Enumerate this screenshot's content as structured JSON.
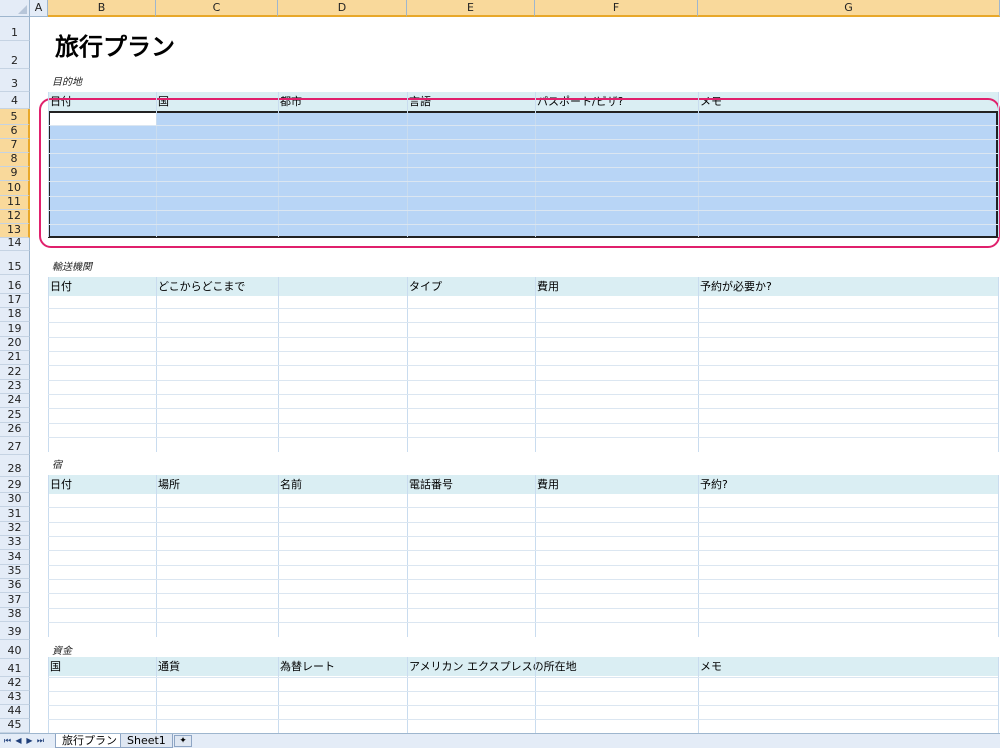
{
  "columns": [
    "A",
    "B",
    "C",
    "D",
    "E",
    "F",
    "G"
  ],
  "rows": [
    "1",
    "2",
    "3",
    "4",
    "5",
    "6",
    "7",
    "8",
    "9",
    "10",
    "11",
    "12",
    "13",
    "14",
    "15",
    "16",
    "17",
    "18",
    "19",
    "20",
    "21",
    "22",
    "23",
    "24",
    "25",
    "26",
    "27",
    "28",
    "29",
    "30",
    "31",
    "32",
    "33",
    "34",
    "35",
    "36",
    "37",
    "38",
    "39",
    "40",
    "41",
    "42",
    "43",
    "44",
    "45"
  ],
  "selected_columns": [
    "B",
    "C",
    "D",
    "E",
    "F",
    "G"
  ],
  "selected_rows": [
    "5",
    "6",
    "7",
    "8",
    "9",
    "10",
    "11",
    "12",
    "13"
  ],
  "title": "旅行プラン",
  "sections": [
    {
      "label": "目的地",
      "headers": [
        "日付",
        "国",
        "都市",
        "言語",
        "パスポート/ビザ?",
        "メモ"
      ]
    },
    {
      "label": "輸送機関",
      "headers": [
        "日付",
        "どこからどこまで",
        "タイプ",
        "費用",
        "予約が必要か?"
      ]
    },
    {
      "label": "宿",
      "headers": [
        "日付",
        "場所",
        "名前",
        "電話番号",
        "費用",
        "予約?"
      ]
    },
    {
      "label": "資金",
      "headers": [
        "国",
        "通貨",
        "為替レート",
        "アメリカン エクスプレスの所在地",
        "メモ"
      ]
    }
  ],
  "tabs": {
    "sheet1": "旅行プラン",
    "sheet2": "Sheet1",
    "insert_icon": "insert-sheet-icon"
  },
  "colors": {
    "selection": "#b8d5f6",
    "header_fill": "#daeef3",
    "highlight": "#e0206c",
    "selected_header": "#f9d99b"
  }
}
